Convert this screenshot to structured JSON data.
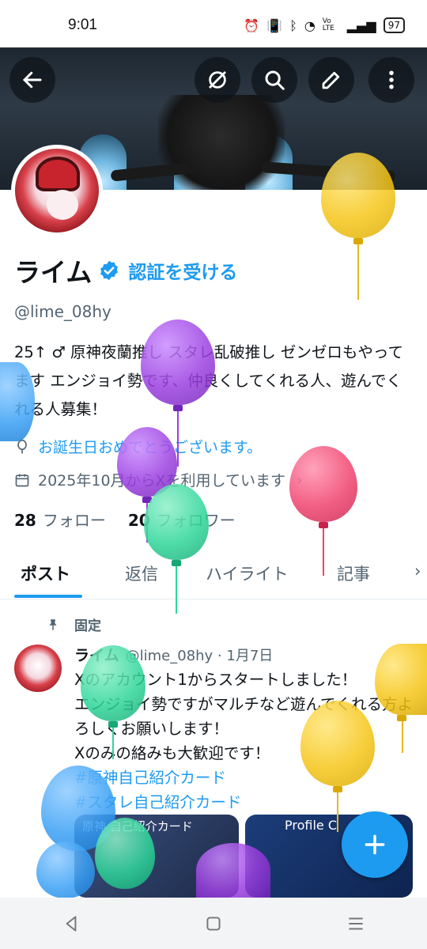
{
  "status_bar": {
    "time": "9:01",
    "battery": "97",
    "net": "Vo LTE"
  },
  "profile": {
    "name": "ライム",
    "verify_cta": "認証を受ける",
    "handle": "@lime_08hy",
    "bio": "25↑ ♂ 原神夜蘭推し スタレ乱破推し ゼンゼロもやってます エンジョイ勢です、仲良くしてくれる人、遊んでくれる人募集！",
    "birthday_msg": "お誕生日おめでとうございます。",
    "joined": "2025年10月からXを利用しています",
    "following_count": "28",
    "following_label": "フォロー",
    "followers_count": "20",
    "followers_label": "フォロワー"
  },
  "tabs": [
    "ポスト",
    "返信",
    "ハイライト",
    "記事"
  ],
  "post": {
    "pinned_label": "固定",
    "author": "ライム",
    "handle_date": "@lime_08hy · 1月7日",
    "line1": "Xのアカウント1からスタートしました！",
    "line2": "エンジョイ勢ですがマルチなど遊んでくれる方よろしくお願いします！",
    "line3": "Xのみの絡みも大歓迎です！",
    "hashtag1": "#原神自己紹介カード",
    "hashtag2": "#スタレ自己紹介カード",
    "card1_title": "原神 自己紹介カード",
    "card2_title": "Profile C"
  },
  "colors": {
    "accent": "#1d9bf0",
    "balloon_yellow": "#f5c518",
    "balloon_purple": "#9b3fe0",
    "balloon_green": "#2fd69a",
    "balloon_pink": "#f0426e",
    "balloon_blue": "#3aa0f5"
  }
}
